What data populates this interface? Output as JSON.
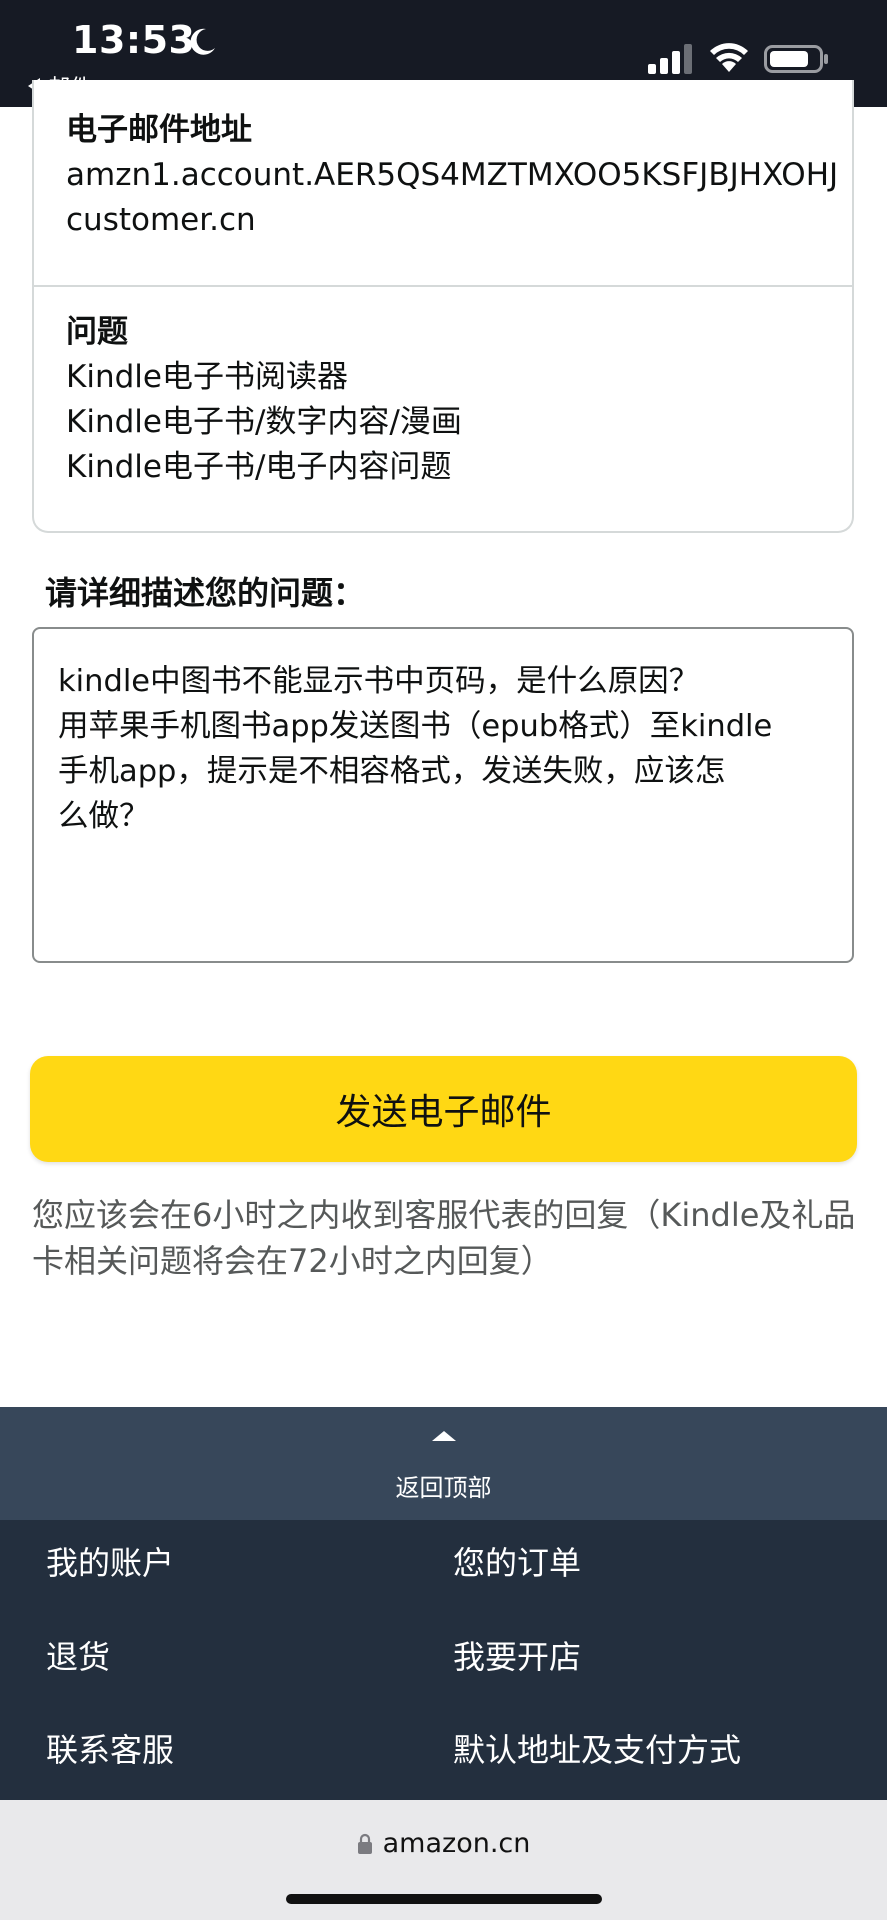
{
  "status_bar": {
    "time": "13:53",
    "back_app": "邮件"
  },
  "info": {
    "email_title": "电子邮件地址",
    "email_lines": [
      "amzn1.account.AER5QS4MZTMXOO5KSFJBJHXOHJ",
      "customer.cn"
    ],
    "issue_title": "问题",
    "issue_lines": [
      "Kindle电子书阅读器",
      "Kindle电子书/数字内容/漫画",
      "Kindle电子书/电子内容问题"
    ]
  },
  "description": {
    "label": "请详细描述您的问题：",
    "value": "kindle中图书不能显示书中页码，是什么原因？\n用苹果手机图书app发送图书（epub格式）至kindle\n手机app，提示是不相容格式，发送失败，应该怎\n么做？"
  },
  "send_button": "发送电子邮件",
  "reply_note": "您应该会在6小时之内收到客服代表的回复（Kindle及礼品卡相关问题将会在72小时之内回复）",
  "back_to_top": "返回顶部",
  "footer": {
    "links": [
      "我的账户",
      "您的订单",
      "退货",
      "我要开店",
      "联系客服",
      "默认地址及支付方式"
    ]
  },
  "browser": {
    "url": "amazon.cn"
  },
  "icons": {
    "moon": "moon-icon",
    "signal": "cellular-signal-icon",
    "wifi": "wifi-icon",
    "battery": "battery-icon",
    "lock": "lock-icon"
  },
  "colors": {
    "button": "#ffd814",
    "footer": "#232f3e",
    "back_to_top": "#37475a"
  }
}
